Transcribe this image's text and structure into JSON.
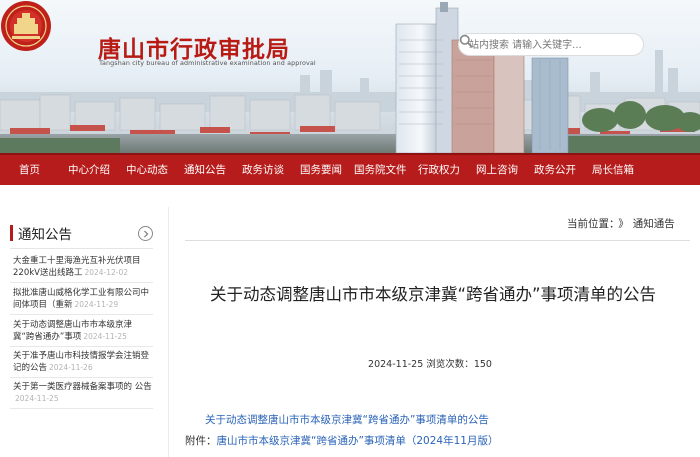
{
  "site": {
    "title": "唐山市行政审批局",
    "subtitle": "Tangshan city bureau of administrative examination and approval"
  },
  "search": {
    "placeholder": "站内搜索 请输入关键字..."
  },
  "nav": {
    "items": [
      "首页",
      "中心介绍",
      "中心动态",
      "通知公告",
      "政务访谈",
      "国务要闻",
      "国务院文件",
      "行政权力",
      "网上咨询",
      "政务公开",
      "局长信箱"
    ]
  },
  "sidebar": {
    "title": "通知公告",
    "items": [
      {
        "text": "大金重工十里海渔光互补光伏项目220kV送出线路工",
        "date": "2024-12-02"
      },
      {
        "text": "拟批准唐山威格化学工业有限公司中间体项目（重新",
        "date": "2024-11-29"
      },
      {
        "text": "关于动态调整唐山市市本级京津冀“跨省通办”事项",
        "date": "2024-11-25"
      },
      {
        "text": "关于准予唐山市科技情报学会注销登记的公告",
        "date": "2024-11-26"
      },
      {
        "text": "关于第一类医疗器械备案事项的 公告",
        "date": "2024-11-25"
      }
    ]
  },
  "breadcrumb": {
    "label": "当前位置：",
    "separator": "》",
    "current": "通知通告"
  },
  "article": {
    "title": "关于动态调整唐山市市本级京津冀“跨省通办”事项清单的公告",
    "date": "2024-11-25",
    "views_label": "浏览次数：",
    "views": "150",
    "link_text": "关于动态调整唐山市市本级京津冀“跨省通办”事项清单的公告",
    "attachment_label": "附件：",
    "attachment_text": "唐山市市本级京津冀“跨省通办”事项清单（2024年11月版）"
  },
  "colors": {
    "brand_red": "#b71c1c",
    "link_blue": "#2a63b8"
  }
}
